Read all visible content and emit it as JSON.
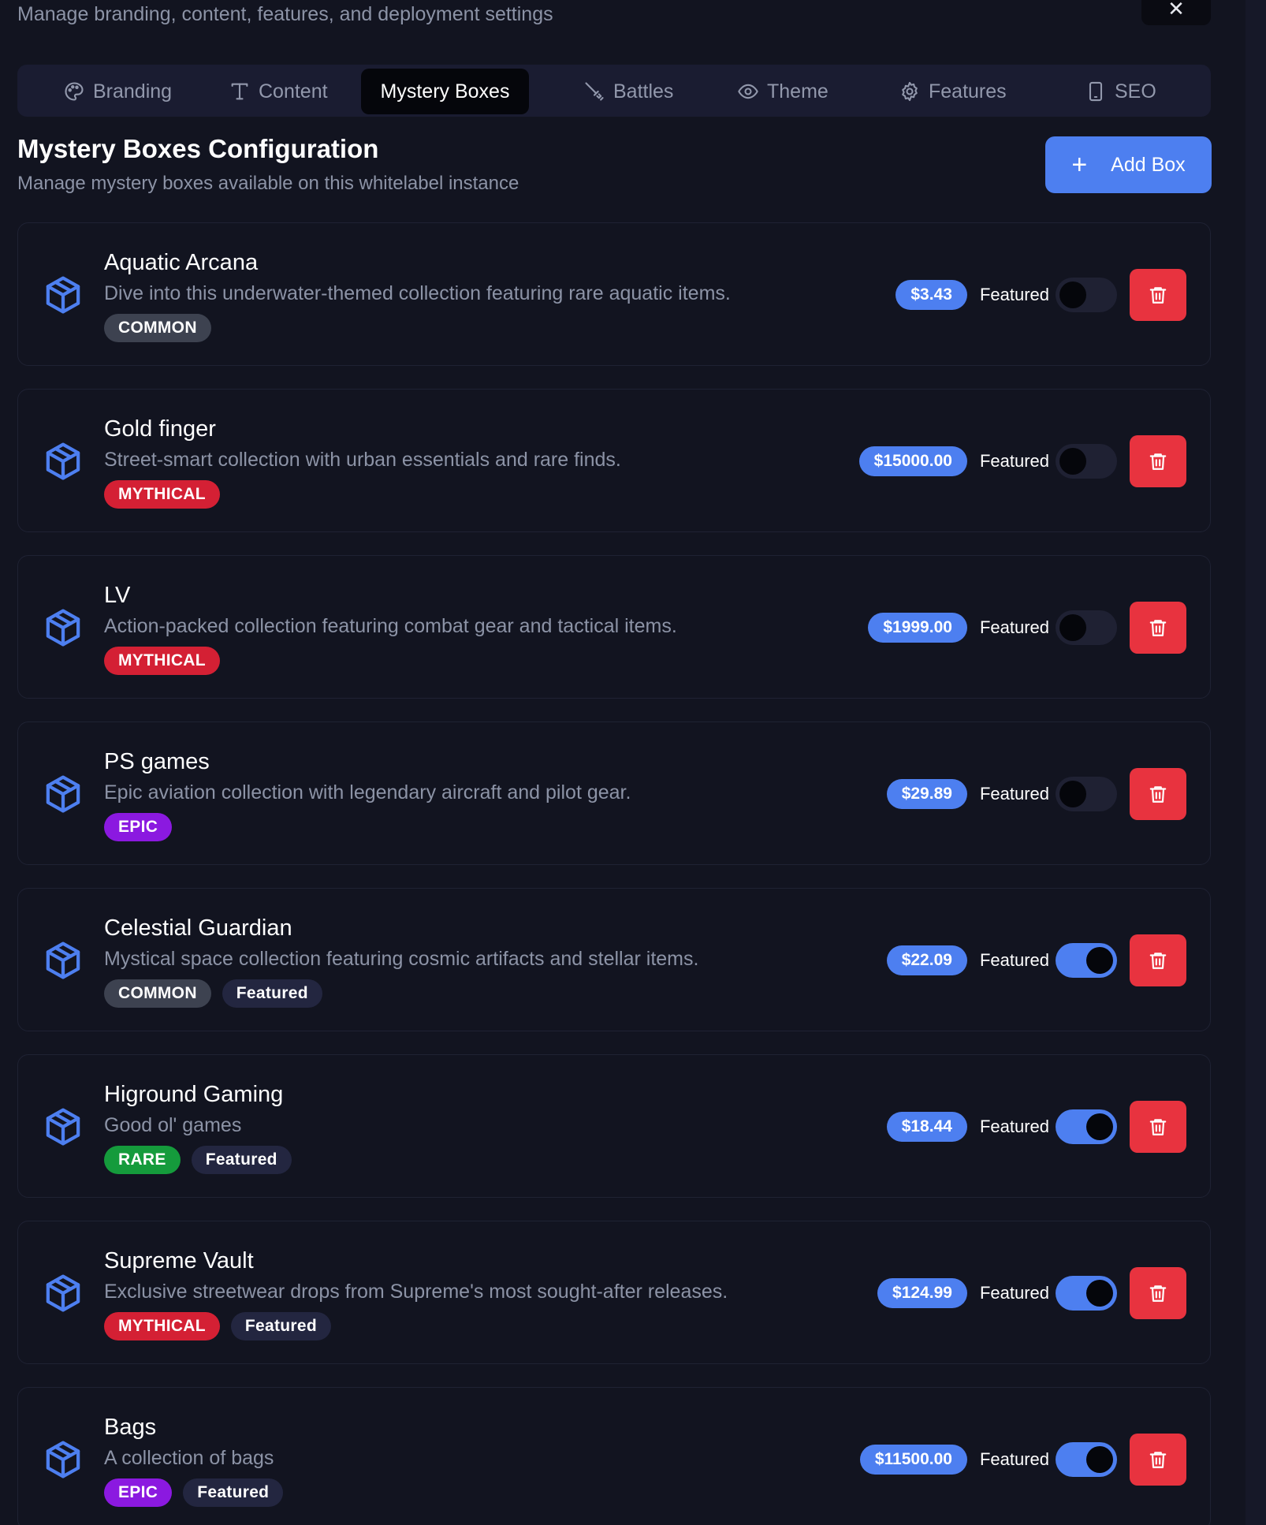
{
  "header": {
    "subtitle": "Manage branding, content, features, and deployment settings",
    "close_glyph": "✕"
  },
  "tabs": [
    {
      "label": "Branding",
      "icon": "palette-icon"
    },
    {
      "label": "Content",
      "icon": "type-icon"
    },
    {
      "label": "Mystery Boxes",
      "icon": "",
      "active": true
    },
    {
      "label": "Battles",
      "icon": "sword-icon"
    },
    {
      "label": "Theme",
      "icon": "eye-icon"
    },
    {
      "label": "Features",
      "icon": "gear-icon"
    },
    {
      "label": "SEO",
      "icon": "smartphone-icon"
    }
  ],
  "section": {
    "title": "Mystery Boxes Configuration",
    "subtitle": "Manage mystery boxes available on this whitelabel instance",
    "add_button_label": "Add Box",
    "add_button_glyph": "+"
  },
  "featured_toggle_label": "Featured",
  "featured_badge_label": "Featured",
  "colors": {
    "accent": "#4d7ff0",
    "danger": "#e8333f",
    "common": "#3d4250",
    "mythical": "#d42034",
    "epic": "#8b19e0",
    "rare": "#159b3c"
  },
  "boxes": [
    {
      "name": "Aquatic Arcana",
      "description": "Dive into this underwater-themed collection featuring rare aquatic items.",
      "rarity": "COMMON",
      "price": "$3.43",
      "featured": false
    },
    {
      "name": "Gold finger",
      "description": "Street-smart collection with urban essentials and rare finds.",
      "rarity": "MYTHICAL",
      "price": "$15000.00",
      "featured": false
    },
    {
      "name": "LV",
      "description": "Action-packed collection featuring combat gear and tactical items.",
      "rarity": "MYTHICAL",
      "price": "$1999.00",
      "featured": false
    },
    {
      "name": "PS games",
      "description": "Epic aviation collection with legendary aircraft and pilot gear.",
      "rarity": "EPIC",
      "price": "$29.89",
      "featured": false
    },
    {
      "name": "Celestial Guardian",
      "description": "Mystical space collection featuring cosmic artifacts and stellar items.",
      "rarity": "COMMON",
      "price": "$22.09",
      "featured": true
    },
    {
      "name": "Higround Gaming",
      "description": "Good ol' games",
      "rarity": "RARE",
      "price": "$18.44",
      "featured": true
    },
    {
      "name": "Supreme Vault",
      "description": "Exclusive streetwear drops from Supreme's most sought-after releases.",
      "rarity": "MYTHICAL",
      "price": "$124.99",
      "featured": true
    },
    {
      "name": "Bags",
      "description": "A collection of bags",
      "rarity": "EPIC",
      "price": "$11500.00",
      "featured": true
    }
  ]
}
